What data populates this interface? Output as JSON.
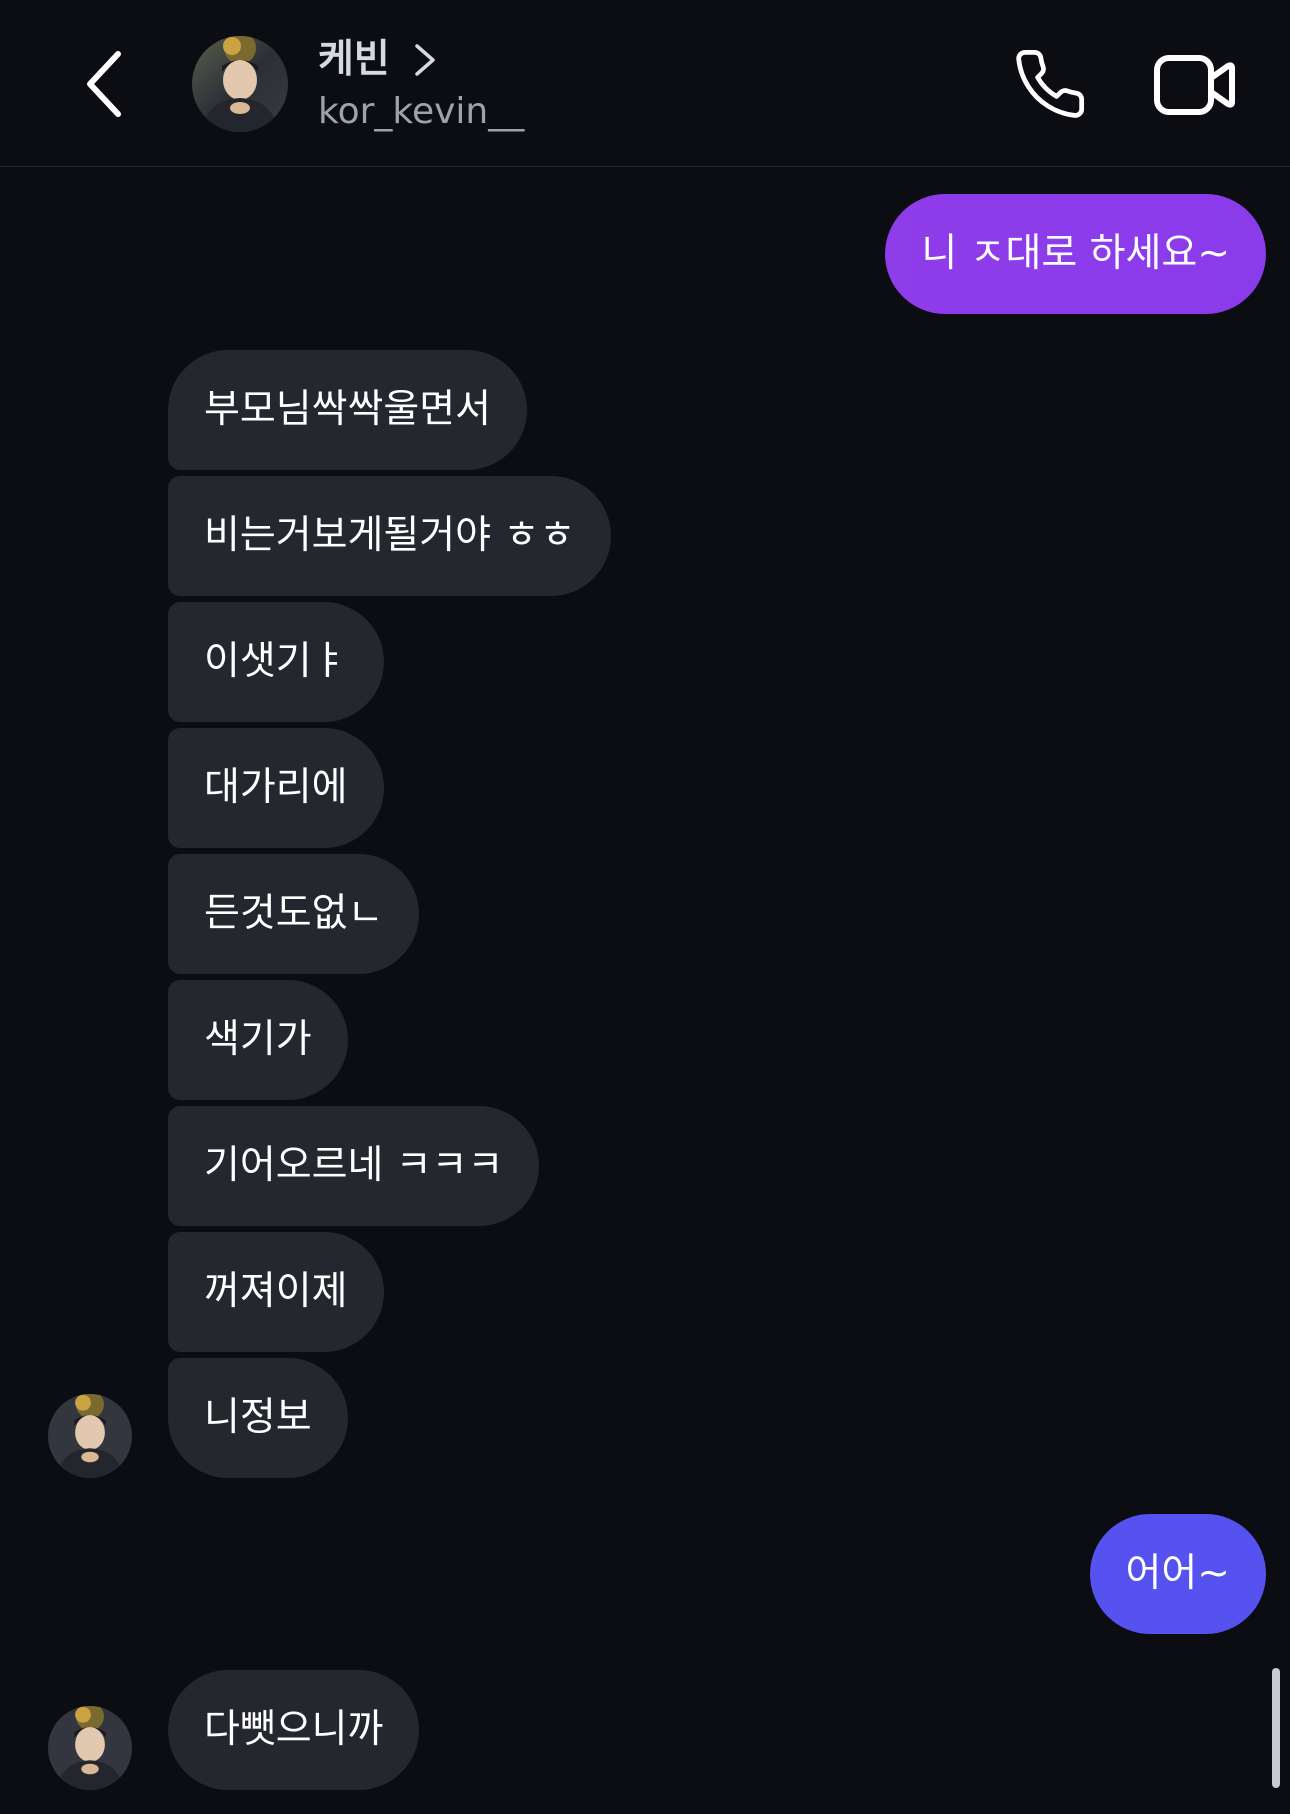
{
  "header": {
    "back_icon": "chevron-left-icon",
    "contact_name": "케빈",
    "name_chevron_icon": "chevron-right-icon",
    "handle": "kor_kevin__",
    "call_icon": "phone-icon",
    "video_icon": "video-camera-icon"
  },
  "colors": {
    "background": "#0b0d12",
    "incoming_bubble": "#24272e",
    "outgoing_purple": "#8b3bea",
    "outgoing_indigo": "#5552ef",
    "text": "#ffffff"
  },
  "messages": [
    {
      "from": "me",
      "text": "니 ㅈ대로 하세요~"
    },
    {
      "from": "kevin",
      "text": "부모님싹싹울면서"
    },
    {
      "from": "kevin",
      "text": "비는거보게될거야 ㅎㅎ"
    },
    {
      "from": "kevin",
      "text": "이샛기ㅑ"
    },
    {
      "from": "kevin",
      "text": "대가리에"
    },
    {
      "from": "kevin",
      "text": "든것도없ㄴ"
    },
    {
      "from": "kevin",
      "text": "색기가"
    },
    {
      "from": "kevin",
      "text": "기어오르네 ㅋㅋㅋ"
    },
    {
      "from": "kevin",
      "text": "꺼져이제"
    },
    {
      "from": "kevin",
      "text": "니정보"
    },
    {
      "from": "me",
      "text": "어어~"
    },
    {
      "from": "kevin",
      "text": "다뺏으니까"
    }
  ]
}
